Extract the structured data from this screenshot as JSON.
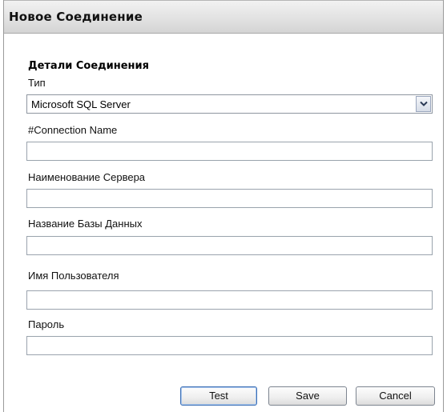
{
  "dialog": {
    "title": "Новое Соединение",
    "section_title": "Детали Соединения"
  },
  "fields": {
    "type": {
      "label": "Тип",
      "value": "Microsoft SQL Server"
    },
    "connection_name": {
      "label": "#Connection Name",
      "value": ""
    },
    "server_name": {
      "label": "Наименование Сервера",
      "value": ""
    },
    "database_name": {
      "label": "Название Базы Данных",
      "value": ""
    },
    "username": {
      "label": "Имя Пользователя",
      "value": ""
    },
    "password": {
      "label": "Пароль",
      "value": ""
    }
  },
  "buttons": {
    "test": "Test",
    "save": "Save",
    "cancel": "Cancel"
  },
  "icons": {
    "dropdown": "chevron-down-icon"
  }
}
